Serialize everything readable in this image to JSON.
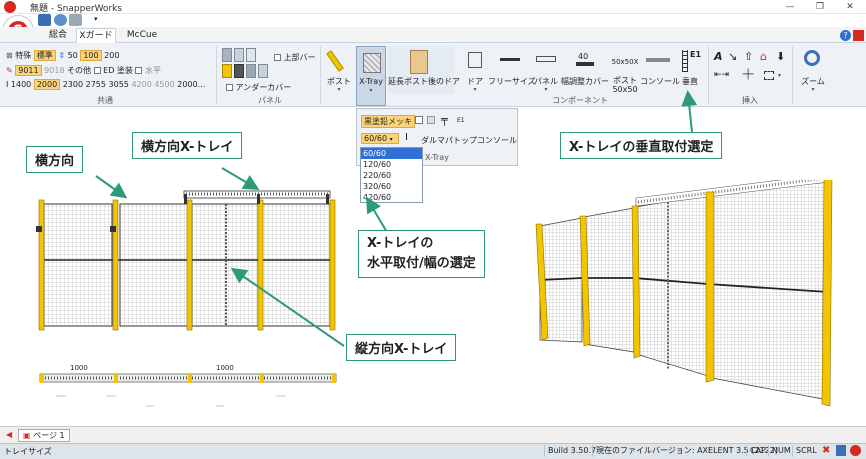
{
  "window": {
    "title": "無題 - SnapperWorks",
    "minimize": "—",
    "restore": "❐",
    "close": "✕"
  },
  "app_logo": "S",
  "tabs": [
    "総合",
    "Xガード",
    "McCue"
  ],
  "ribbon": {
    "common": {
      "row1": [
        "特殊",
        "標準",
        "50",
        "100",
        "200"
      ],
      "row2": [
        "9011",
        "9018",
        "その他",
        "ED 塗装",
        "水平"
      ],
      "row3": [
        "1400",
        "2000",
        "2300",
        "2755",
        "3055",
        "4200",
        "4500",
        "2000..."
      ],
      "label": "共通"
    },
    "panel": {
      "upper_bar": "上部バー",
      "under_cover": "アンダーカバー",
      "label": "パネル"
    },
    "post": "ポスト",
    "xtray": "X-Tray",
    "extended_post_door": "延長ポスト後のドア",
    "component": {
      "items": [
        "ドア",
        "フリーサイズ",
        "パネル",
        "幅調整カバー",
        "ポスト\n50x50",
        "コンソール",
        "垂直"
      ],
      "adj_num": "40",
      "post_num": "50x50X",
      "vertical_code": "E1",
      "label": "コンポーネント"
    },
    "insert": {
      "label": "挿入"
    },
    "zoom": "ズーム"
  },
  "xtray_panel": {
    "finish": "黒塗鉛メッキ",
    "e1": "E1",
    "selected": "60/60",
    "buttons": [
      "ダルマパ",
      "トップ",
      "コンソール"
    ],
    "label": "X-Tray",
    "options": [
      "60/60",
      "120/60",
      "220/60",
      "320/60",
      "420/60"
    ]
  },
  "callouts": {
    "horizontal": "横方向",
    "horizontal_xtray": "横方向X-トレイ",
    "vertical_mount": "X-トレイの垂直取付選定",
    "horizontal_mount_line1": "X-トレイの",
    "horizontal_mount_line2": "水平取付/幅の選定",
    "vertical_xtray": "縦方向X-トレイ"
  },
  "drawing": {
    "dim1": "1000",
    "dim2": "1000"
  },
  "page_tab": "ページ 1",
  "status": {
    "left": "トレイサイズ",
    "build": "Build 3.50.7",
    "version": "現在のファイルバージョン: AXELENT 3.5 (2122)",
    "cap": "CAP",
    "num": "NUM",
    "scrl": "SCRL"
  },
  "colors": {
    "accent": "#2e9a7a",
    "post_yellow": "#f2c500",
    "highlight": "#fbd47a",
    "selection": "#2f6fd6"
  }
}
